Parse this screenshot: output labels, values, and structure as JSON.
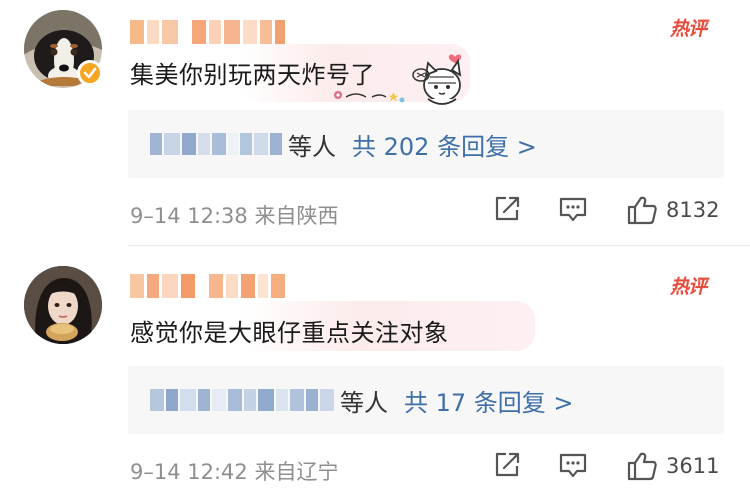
{
  "comments": [
    {
      "hot_badge": "热评",
      "text": "集美你别玩两天炸号了",
      "reply_box": {
        "who_suffix": "等人",
        "count_label": "共 202 条回复 >"
      },
      "meta": "9–14 12:38 来自陕西",
      "likes": "8132"
    },
    {
      "hot_badge": "热评",
      "text": "感觉你是大眼仔重点关注对象",
      "reply_box": {
        "who_suffix": "等人",
        "count_label": "共 17 条回复 >"
      },
      "meta": "9–14 12:42 来自辽宁",
      "likes": "3611"
    }
  ],
  "colors": {
    "hot_badge": "#e84c3d",
    "reply_link": "#3e6fa8",
    "meta_text": "#8f8f8f",
    "verified_badge": "#f5a623"
  },
  "icons": [
    "share-icon",
    "comment-icon",
    "like-icon",
    "verified-icon"
  ]
}
